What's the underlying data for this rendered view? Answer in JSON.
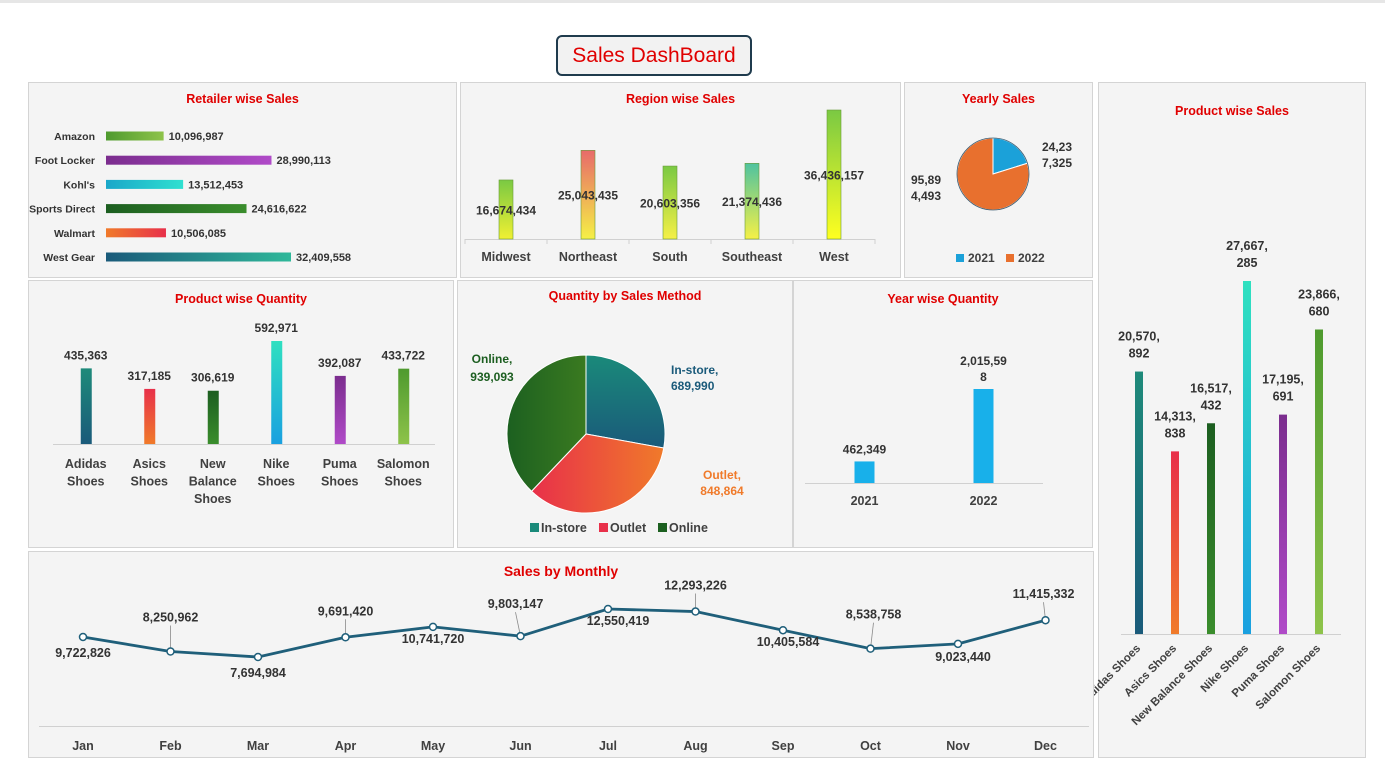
{
  "dashboard_title": "Sales DashBoard",
  "colors": {
    "title_red": "#e00000",
    "line": "#1f5f7a"
  },
  "chart_data": [
    {
      "id": "retailer",
      "type": "bar",
      "orientation": "horizontal",
      "title": "Retailer wise Sales",
      "categories": [
        "Amazon",
        "Foot Locker",
        "Kohl's",
        "Sports Direct",
        "Walmart",
        "West Gear"
      ],
      "values": [
        10096987,
        28990113,
        13512453,
        24616622,
        10506085,
        32409558
      ],
      "labels": [
        "10,096,987",
        "28,990,113",
        "13,512,453",
        "24,616,622",
        "10,506,085",
        "32,409,558"
      ],
      "colors": [
        [
          "#4e9a2e",
          "#8ec34a"
        ],
        [
          "#7b2d8e",
          "#b04ac8"
        ],
        [
          "#1aa7c9",
          "#2fe0d0"
        ],
        [
          "#1c5e20",
          "#3a8d2c"
        ],
        [
          "#f07a2a",
          "#e8304a"
        ],
        [
          "#1a5a7a",
          "#2fb89a"
        ]
      ]
    },
    {
      "id": "region",
      "type": "bar",
      "title": "Region wise Sales",
      "categories": [
        "Midwest",
        "Northeast",
        "South",
        "Southeast",
        "West"
      ],
      "values": [
        16674434,
        25043435,
        20603356,
        21374436,
        36436157
      ],
      "labels": [
        "16,674,434",
        "25,043,435",
        "20,603,356",
        "21,374,436",
        "36,436,157"
      ],
      "colors": [
        [
          "#7ac943",
          "#f0f032"
        ],
        [
          "#e86a6a",
          "#f5f046"
        ],
        [
          "#7ac943",
          "#f5f046"
        ],
        [
          "#4fc3a0",
          "#f5f046"
        ],
        [
          "#7ac943",
          "#ffff20"
        ]
      ]
    },
    {
      "id": "yearly",
      "type": "pie",
      "title": "Yearly Sales",
      "categories": [
        "2021",
        "2022"
      ],
      "values": [
        24237325,
        95894493
      ],
      "labels": [
        [
          "24,23",
          "7,325"
        ],
        [
          "95,89",
          "4,493"
        ]
      ],
      "colors": [
        "#1ba1d9",
        "#e8702e"
      ]
    },
    {
      "id": "product_qty",
      "type": "bar",
      "title": "Product wise Quantity",
      "categories": [
        [
          "Adidas",
          "Shoes"
        ],
        [
          "Asics",
          "Shoes"
        ],
        [
          "New",
          "Balance",
          "Shoes"
        ],
        [
          "Nike",
          "Shoes"
        ],
        [
          "Puma",
          "Shoes"
        ],
        [
          "Salomon",
          "Shoes"
        ]
      ],
      "values": [
        435363,
        317185,
        306619,
        592971,
        392087,
        433722
      ],
      "labels": [
        "435,363",
        "317,185",
        "306,619",
        "592,971",
        "392,087",
        "433,722"
      ],
      "colors": [
        [
          "#1e8a7a",
          "#1a5a7a"
        ],
        [
          "#e8304a",
          "#f07a2a"
        ],
        [
          "#1c5e20",
          "#3a8d2c"
        ],
        [
          "#2fe0c0",
          "#1aa0e0"
        ],
        [
          "#7b2d8e",
          "#b04ac8"
        ],
        [
          "#4e9a2e",
          "#8ec34a"
        ]
      ]
    },
    {
      "id": "method",
      "type": "pie",
      "title": "Quantity by Sales Method",
      "categories": [
        "In-store",
        "Outlet",
        "Online"
      ],
      "values": [
        689990,
        848864,
        939093
      ],
      "labels": [
        [
          "In-store,",
          "689,990"
        ],
        [
          "Outlet,",
          "848,864"
        ],
        [
          "Online,",
          "939,093"
        ]
      ],
      "label_colors": [
        "#1a5a7a",
        "#f07a2a",
        "#1c5e20"
      ],
      "colors": [
        [
          "#1a8a7a",
          "#1a5a7a"
        ],
        [
          "#e8304a",
          "#f07a2a"
        ],
        [
          "#1c6020",
          "#3a7a20"
        ]
      ]
    },
    {
      "id": "year_qty",
      "type": "bar",
      "title": "Year wise Quantity",
      "categories": [
        "2021",
        "2022"
      ],
      "values": [
        462349,
        2015598
      ],
      "labels": [
        [
          "462,349"
        ],
        [
          "2,015,59",
          "8"
        ]
      ],
      "colors": [
        [
          "#18b0ea",
          "#18b0ea"
        ],
        [
          "#18b0ea",
          "#18b0ea"
        ]
      ]
    },
    {
      "id": "monthly",
      "type": "line",
      "title": "Sales by Monthly",
      "categories": [
        "Jan",
        "Feb",
        "Mar",
        "Apr",
        "May",
        "Jun",
        "Jul",
        "Aug",
        "Sep",
        "Oct",
        "Nov",
        "Dec"
      ],
      "values": [
        9722826,
        8250962,
        7694984,
        9691420,
        10741720,
        9803147,
        12550419,
        12293226,
        10405584,
        8538758,
        9023440,
        11415332
      ],
      "labels": [
        "9,722,826",
        "8,250,962",
        "7,694,984",
        "9,691,420",
        "10,741,720",
        "9,803,147",
        "12,550,419",
        "12,293,226",
        "10,405,584",
        "8,538,758",
        "9,023,440",
        "11,415,332"
      ]
    },
    {
      "id": "product_sales",
      "type": "bar",
      "title": "Product wise Sales",
      "categories": [
        "Adidas Shoes",
        "Asics Shoes",
        "New Balance Shoes",
        "Nike Shoes",
        "Puma Shoes",
        "Salomon Shoes"
      ],
      "values": [
        20570892,
        14313838,
        16517432,
        27667285,
        17195691,
        23866680
      ],
      "labels": [
        [
          "20,570,",
          "892"
        ],
        [
          "14,313,",
          "838"
        ],
        [
          "16,517,",
          "432"
        ],
        [
          "27,667,",
          "285"
        ],
        [
          "17,195,",
          "691"
        ],
        [
          "23,866,",
          "680"
        ]
      ],
      "colors": [
        [
          "#1e8a7a",
          "#1a5a7a"
        ],
        [
          "#e8304a",
          "#f07a2a"
        ],
        [
          "#1c5e20",
          "#3a8d2c"
        ],
        [
          "#2fe0c0",
          "#1aa0e0"
        ],
        [
          "#7b2d8e",
          "#b04ac8"
        ],
        [
          "#4e9a2e",
          "#8ec34a"
        ]
      ]
    }
  ]
}
